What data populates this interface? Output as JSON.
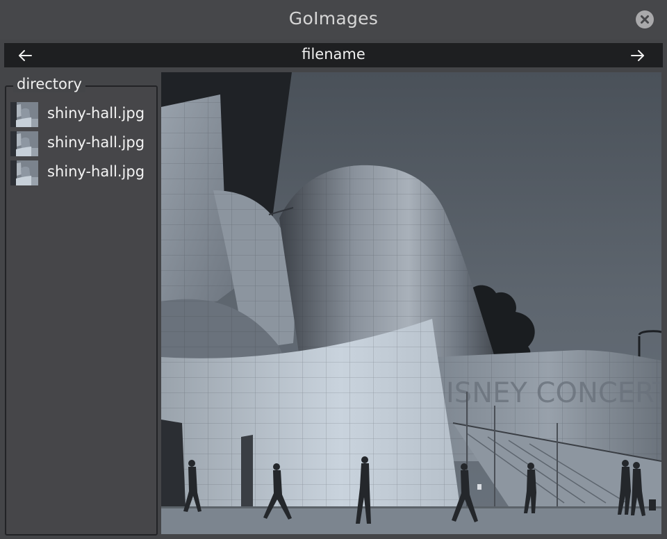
{
  "window": {
    "title": "GoImages"
  },
  "nav": {
    "filename": "filename"
  },
  "directory": {
    "legend": "directory",
    "files": [
      {
        "name": "shiny-hall.jpg"
      },
      {
        "name": "shiny-hall.jpg"
      },
      {
        "name": "shiny-hall.jpg"
      }
    ]
  },
  "icons": {
    "close": "close-icon",
    "back": "arrow-left-icon",
    "forward": "arrow-right-icon"
  },
  "colors": {
    "background": "#444548",
    "navbar": "#1e1f21",
    "close_button": "#a9a9ab"
  }
}
